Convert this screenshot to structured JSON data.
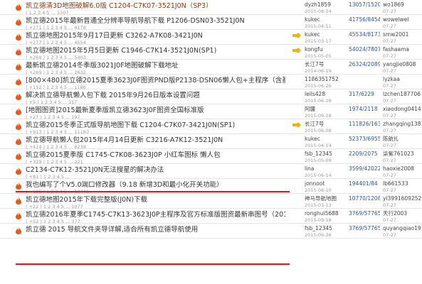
{
  "colors": {
    "flame": "#e8591a",
    "redline": "#e3141b",
    "reply_count": "#2b55a0",
    "badge": "#f0b400"
  },
  "thread_icon": "flame-icon",
  "badge_icon": "medal-icon",
  "threads": [
    {
      "title": "凯立德清3D地图破解6.0版 C1204-C7K07-3521J0N（SP3）",
      "meta": "( 1 2 3 4 5 ... 1307",
      "author": "dyzh1859",
      "author_date": "2015-08-24",
      "replies": "13057/1520",
      "views": "",
      "last_user": "wo1869",
      "last_date": "07-27",
      "badge": false
    },
    {
      "title": "凯立德2015年最新普通全分辨率导航导航下载 P1206-DSN03-3521J0N",
      "meta": "( +271 ) 1 2 3 4 5 ... 4178",
      "author": "kukec",
      "author_date": "2015-04-11",
      "replies": "41756/8454",
      "views": "",
      "last_user": "wowelwel",
      "last_date": "07-27",
      "badge": false
    },
    {
      "title": "凯立德地图2015年9月17日更新 C3262-A7K08-3421J0N",
      "meta": "( +277 ) 1 2 3 4 5 ... 4554",
      "author": "kukec",
      "author_date": "2015-03-17",
      "replies": "45534/8173",
      "views": "",
      "last_user": "smw2001",
      "last_date": "07-27",
      "badge": true
    },
    {
      "title": "凯立德地图2015年5月5日更新 C1946-C7K14-3521J0N(SP1)",
      "meta": "( +269 ) 1 2 3 4 5 ... 5403",
      "author": "kongfu",
      "author_date": "2015-05-05",
      "replies": "54024/7807",
      "views": "",
      "last_user": "fashaama",
      "last_date": "07-27",
      "badge": true
    },
    {
      "title": "最新凯立德2014冬季版3021J0F地图破解下载地址",
      "meta": "( +269 ) 1 2 3 4 5 ... 2632",
      "author": "长江7号",
      "author_date": "2014-06-19",
      "replies": "26324/2089",
      "views": "",
      "last_user": "yangjie0808",
      "last_date": "07-27",
      "badge": false
    },
    {
      "title": "[800×480]凯立德2015夏季3623J0F图资PND版P2138-DSN06懒人包+主程序（含基础包）",
      "meta": "( +152 ) 1 2 3 4 5 ... 1186",
      "author": "1186351752",
      "author_date": "2015-06-26",
      "replies": "",
      "views": "",
      "last_user": "lyzkaa",
      "last_date": "07-27",
      "badge": false
    },
    {
      "title": "解决凯立德导航懒人包下载 2015年9月26日版本设置问题",
      "meta": "( +5 ) 1 2 3 4 5 ... 317",
      "author": "leils428",
      "author_date": "2015-06-28",
      "replies": "317/6229",
      "views": "",
      "last_user": "lzchen187706",
      "last_date": "07-27",
      "badge": false
    },
    {
      "title": "[地图图资]2015最新夏季版凯立德3623J0F图资全国标准版",
      "meta": "( +27 ) 1 2 3 4 5 ... 197",
      "author": "阿疆",
      "author_date": "2015-09-18",
      "replies": "1974/2118",
      "views": "",
      "last_user": "xiaodong0414",
      "last_date": "07-27",
      "badge": false
    },
    {
      "title": "凯立德2015冬季正式版导航地图下载 C1204-C7K07-3421J0N(SP1)",
      "meta": "( +913 ) 1 2 3 4 5 ... 11183",
      "author": "长江7号",
      "author_date": "2015-06-08",
      "replies": "111826/163",
      "views": "",
      "last_user": "zhangqing1381",
      "last_date": "07-27",
      "badge": true
    },
    {
      "title": "凯立德导航懒人包2015年4月14日更新 C3216-A7K12-3521J0N",
      "meta": "( +414 ) 1 2 3 4 5 ... 6238",
      "author": "kukec",
      "author_date": "2015-04-14",
      "replies": "52373/6955",
      "views": "",
      "last_user": "陈航扎",
      "last_date": "07-27",
      "badge": false
    },
    {
      "title": "凯立德2015夏季版 C1745-C7K08-3623J0P 小红车图标 懒人包",
      "meta": "( +329 ) 1 2 3 4 5 ... 221",
      "author": "fsb_12345",
      "author_date": "2015-05-09",
      "replies": "2209/2075",
      "views": "",
      "last_user": "柒紫761023",
      "last_date": "07-27",
      "badge": false
    },
    {
      "title": "C2134-C7K12-3521J0N无法搜星的解决办法",
      "meta": "( +81 ) 1 2 3 4 5 ...",
      "author": "lina",
      "author_date": "2015-06-14",
      "replies": "3599/42022",
      "views": "",
      "last_user": "haoxie2008",
      "last_date": "07-27",
      "badge": false
    },
    {
      "title": "我也编写了个V5.0端口修改器（9.18 新增3D和最小化开关功能）",
      "meta": "( +695 ) 1 2 3 4 5 ... 19441",
      "author": "jonnoot",
      "author_date": "2015-08-10",
      "replies": "194401/84",
      "views": "",
      "last_user": "lb661533",
      "last_date": "07-27",
      "badge": false
    },
    {
      "title": "凯立德地图2015年下载完整版(J0N)下载",
      "meta": "( +22 ) 1 2 3 4 5 ... 1077",
      "author": "神马导航地图",
      "author_date": "2015-03-13",
      "replies": "10770/1208",
      "views": "",
      "last_user": "yl3991609252",
      "last_date": "07-27",
      "badge": false
    },
    {
      "title": "凯立德2016年夏季C1745-C7K13-3623J0P主程序及官方标准版图资最新串图号（2015）1274",
      "meta": "( +52 ) 1 2 3 4 5 ... 377",
      "author": "ronghui5688",
      "author_date": "2015-09-18",
      "replies": "3769/57765",
      "views": "",
      "last_user": "天行2003",
      "last_date": "07-27",
      "badge": false
    },
    {
      "title": "凯立德 2015 导航文件夹导详解,适合所有凯立德导航使用",
      "meta": "",
      "author": "fsb_12345",
      "author_date": "2015-06-26",
      "replies": "3769/57765",
      "views": "",
      "last_user": "quyangqiao1975",
      "last_date": "07-27",
      "badge": false
    }
  ]
}
